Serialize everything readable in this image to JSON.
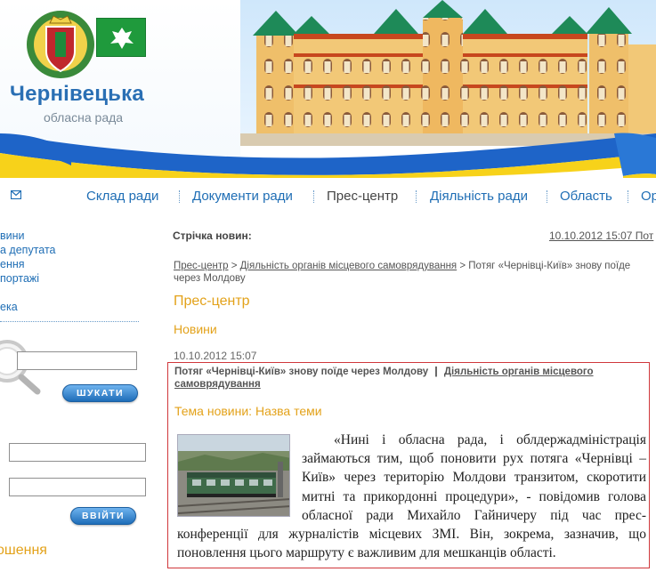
{
  "header": {
    "title": "Чернівецька",
    "subtitle": "обласна рада"
  },
  "nav": {
    "items": [
      {
        "label": "Склад ради",
        "active": false
      },
      {
        "label": "Документи ради",
        "active": false
      },
      {
        "label": "Прес-центр",
        "active": true
      },
      {
        "label": "Діяльність ради",
        "active": false
      },
      {
        "label": "Область",
        "active": false
      },
      {
        "label": "Ор",
        "active": false
      }
    ]
  },
  "sidebar": {
    "links": [
      "вини",
      "а депутата",
      "ення",
      "портажі",
      "ека"
    ],
    "search_button": "ШУКАТИ",
    "login_button": "ВВІЙТИ",
    "bottom_heading": "ошення"
  },
  "news_strip": {
    "label": "Стрічка новин:",
    "item": "10.10.2012 15:07 Пот"
  },
  "breadcrumb": {
    "items": [
      "Прес-центр",
      "Діяльність органів місцевого самоврядування"
    ],
    "current": "Потяг «Чернівці-Київ» знову поїде через Молдову"
  },
  "main": {
    "section_title": "Прес-центр",
    "subsection_title": "Новини",
    "date": "10.10.2012 15:07"
  },
  "news": {
    "title": "Потяг «Чернівці-Київ» знову поїде через Молдову",
    "separator": "|",
    "category": "Діяльність органів місцевого самоврядування",
    "topic": "Тема новини: Назва теми",
    "body": "«Нині і обласна рада, і облдержадміністрація займаються тим, щоб поновити рух потяга «Чернівці – Київ» через територію Молдови транзитом, скоротити митні та прикордонні процедури», - повідомив голова обласної ради Михайло Гайничеру під час прес-конференції для журналістів місцевих ЗМІ. Він, зокрема, зазначив, що поновлення цього маршруту є важливим для мешканців області."
  },
  "colors": {
    "link_blue": "#1f6eb5",
    "accent_orange": "#e3a21a",
    "news_border": "#d0373b",
    "flag_green": "#1f9a3c"
  },
  "icons": [
    "mail-icon",
    "search-magnifier-icon",
    "coat-of-arms-icon",
    "regional-flag-icon",
    "ukrainian-ribbon",
    "building-illustration",
    "train-photo"
  ]
}
